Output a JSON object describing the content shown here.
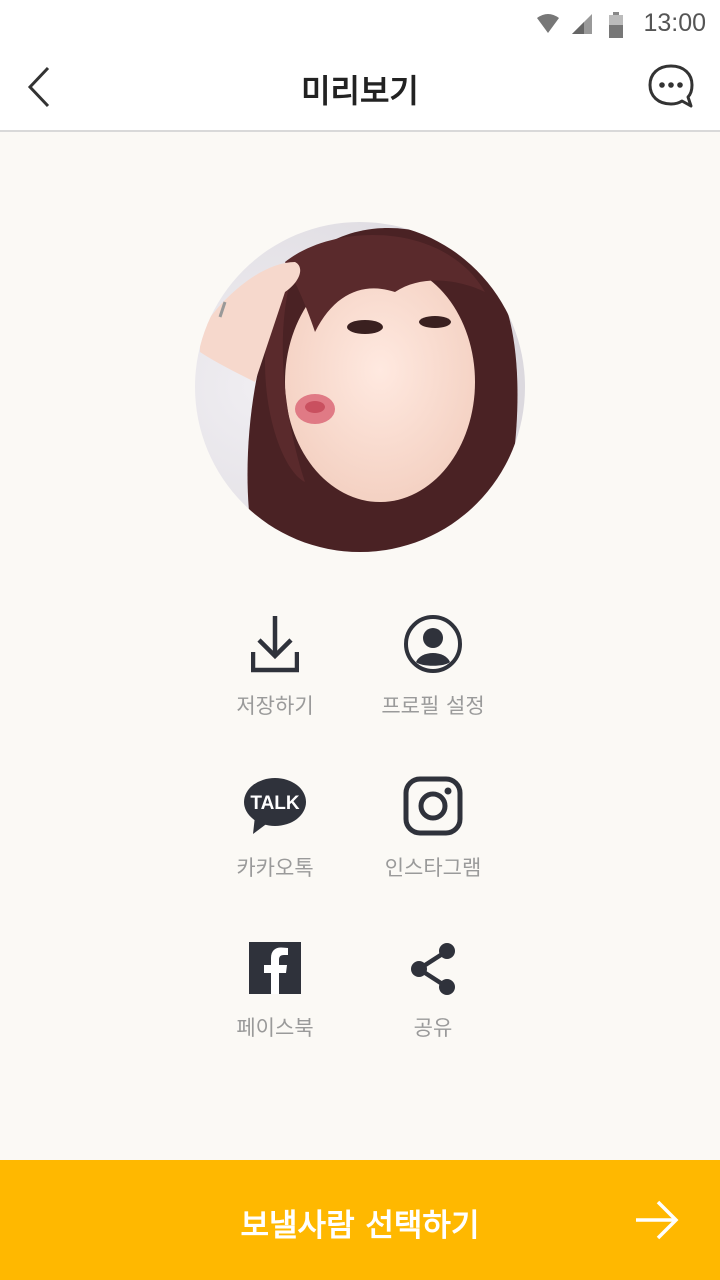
{
  "status_bar": {
    "time": "13:00"
  },
  "app_bar": {
    "title": "미리보기"
  },
  "avatar": {
    "description": "profile photo"
  },
  "actions": [
    {
      "label": "저장하기",
      "icon": "download-icon"
    },
    {
      "label": "프로필 설정",
      "icon": "profile-icon"
    },
    {
      "label": "카카오톡",
      "icon": "kakaotalk-icon",
      "icon_text": "TALK"
    },
    {
      "label": "인스타그램",
      "icon": "instagram-icon"
    },
    {
      "label": "페이스북",
      "icon": "facebook-icon"
    },
    {
      "label": "공유",
      "icon": "share-icon"
    }
  ],
  "bottom_button": {
    "label": "보낼사람 선택하기"
  },
  "colors": {
    "accent": "#ffb800",
    "icon": "#2f323b",
    "background": "#fbf9f5"
  }
}
